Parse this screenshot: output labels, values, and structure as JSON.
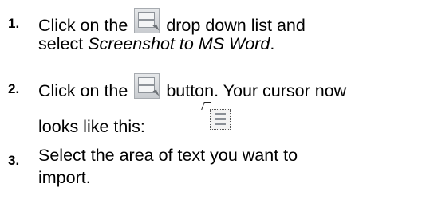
{
  "steps": [
    {
      "number": "1.",
      "line1_before": "Click on the",
      "line1_after": "drop down list and",
      "line2_before": "select ",
      "line2_italic": "Screenshot to MS Word",
      "line2_after": "."
    },
    {
      "number": "2.",
      "line1_before": "Click on the",
      "line1_after": "button. Your cursor now",
      "line2": "looks like this:"
    },
    {
      "number": "3.",
      "line1": "Select the area of text you want to",
      "line2": "import."
    }
  ],
  "icons": {
    "screenshot_button": "screenshot-tool-icon",
    "cursor_preview": "screenshot-cursor-icon"
  }
}
